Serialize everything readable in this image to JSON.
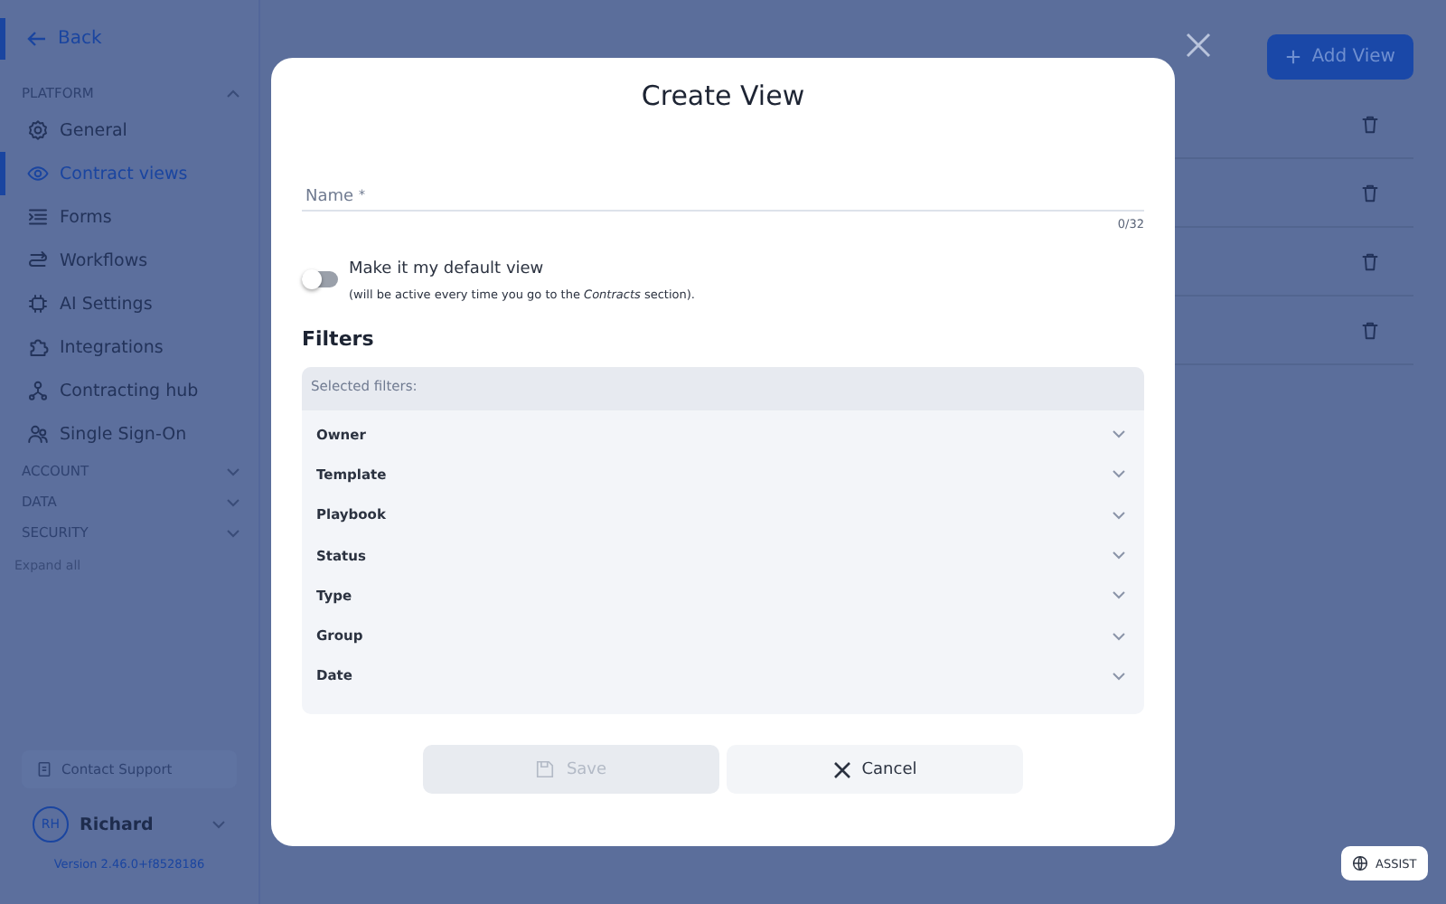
{
  "sidebar": {
    "back": "Back",
    "sections": [
      {
        "title": "PLATFORM",
        "expanded": true,
        "items": [
          {
            "label": "General",
            "selected": false
          },
          {
            "label": "Contract views",
            "selected": true
          },
          {
            "label": "Forms",
            "selected": false
          },
          {
            "label": "Workflows",
            "selected": false
          },
          {
            "label": "AI Settings",
            "selected": false
          },
          {
            "label": "Integrations",
            "selected": false
          },
          {
            "label": "Contracting hub",
            "selected": false
          },
          {
            "label": "Single Sign-On",
            "selected": false
          }
        ]
      },
      {
        "title": "ACCOUNT",
        "expanded": false
      },
      {
        "title": "DATA",
        "expanded": false
      },
      {
        "title": "SECURITY",
        "expanded": false
      }
    ],
    "expand_all": "Expand all",
    "contact_support": "Contact Support",
    "user": {
      "initials": "RH",
      "name": "Richard"
    },
    "version": "Version 2.46.0+f8528186"
  },
  "page": {
    "add_button": "Add View"
  },
  "dialog": {
    "title": "Create View",
    "name_field": {
      "label": "Name",
      "required_mark": "*",
      "counter": "0/32"
    },
    "default_toggle": {
      "on": false,
      "label": "Make it my default view",
      "hint": "(will be active every time you go to the *Contracts* section)."
    },
    "filters_heading": "Filters",
    "selected_filters": "Selected filters:",
    "filters": [
      {
        "label": "Owner",
        "expanded": false
      },
      {
        "label": "Template",
        "expanded": false
      },
      {
        "label": "Playbook",
        "expanded": false
      },
      {
        "label": "Status",
        "expanded": false
      },
      {
        "label": "Type",
        "expanded": false
      },
      {
        "label": "Group",
        "expanded": false
      },
      {
        "label": "Date",
        "expanded": false
      }
    ],
    "buttons": [
      {
        "kind": "save",
        "label": "Save",
        "disabled": true
      },
      {
        "kind": "cancel",
        "label": "Cancel",
        "disabled": false
      }
    ]
  },
  "assist_button": "ASSIST"
}
